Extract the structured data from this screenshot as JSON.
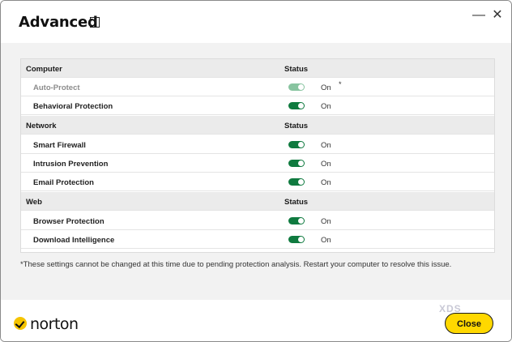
{
  "dialog": {
    "title": "Advanced",
    "help_icon": "?",
    "minimize_icon": "—",
    "close_icon": "✕"
  },
  "sections": [
    {
      "name": "Computer",
      "status_header": "Status",
      "items": [
        {
          "label": "Auto-Protect",
          "state": "On",
          "enabled": false,
          "note": "*"
        },
        {
          "label": "Behavioral Protection",
          "state": "On",
          "enabled": true
        }
      ]
    },
    {
      "name": "Network",
      "status_header": "Status",
      "items": [
        {
          "label": "Smart Firewall",
          "state": "On",
          "enabled": true
        },
        {
          "label": "Intrusion Prevention",
          "state": "On",
          "enabled": true
        },
        {
          "label": "Email Protection",
          "state": "On",
          "enabled": true
        }
      ]
    },
    {
      "name": "Web",
      "status_header": "Status",
      "items": [
        {
          "label": "Browser Protection",
          "state": "On",
          "enabled": true
        },
        {
          "label": "Download Intelligence",
          "state": "On",
          "enabled": true
        }
      ]
    }
  ],
  "footnote": "*These settings cannot be changed at this time due to pending protection analysis. Restart your computer to resolve this issue.",
  "brand": {
    "name": "norton",
    "accent": "#f5c400"
  },
  "close_button": "Close",
  "watermark": "XDS",
  "colors": {
    "toggle_on": "#0f7a3f",
    "toggle_disabled": "#88c4a0",
    "close_button_bg": "#ffd800"
  }
}
